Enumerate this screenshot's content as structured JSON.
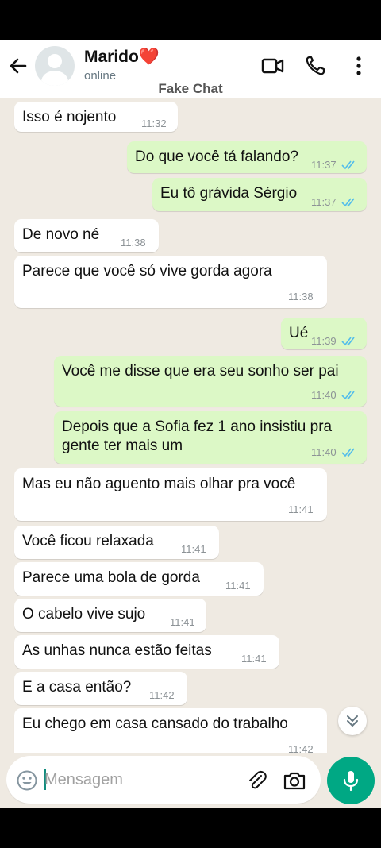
{
  "header": {
    "contact_name": "Marido❤️",
    "status": "online",
    "overlay_label": "Fake Chat"
  },
  "messages": [
    {
      "direction": "in",
      "text": "Isso é nojento",
      "time": "11:32"
    },
    {
      "direction": "out",
      "text": "Do que você tá falando?",
      "time": "11:37",
      "read": true
    },
    {
      "direction": "out",
      "text": "Eu tô grávida Sérgio",
      "time": "11:37",
      "read": true
    },
    {
      "direction": "in",
      "text": "De novo né",
      "time": "11:38"
    },
    {
      "direction": "in",
      "text": "Parece que você só vive gorda agora",
      "time": "11:38"
    },
    {
      "direction": "out",
      "text": "Ué",
      "time": "11:39",
      "read": true
    },
    {
      "direction": "out",
      "text": "Você me disse que era seu sonho ser pai",
      "time": "11:40",
      "read": true
    },
    {
      "direction": "out",
      "text": "Depois que a Sofia fez 1 ano insistiu pra\ngente ter mais um",
      "time": "11:40",
      "read": true
    },
    {
      "direction": "in",
      "text": "Mas eu não aguento mais olhar pra você",
      "time": "11:41"
    },
    {
      "direction": "in",
      "text": "Você ficou relaxada",
      "time": "11:41"
    },
    {
      "direction": "in",
      "text": "Parece uma bola de gorda",
      "time": "11:41"
    },
    {
      "direction": "in",
      "text": "O cabelo vive sujo",
      "time": "11:41"
    },
    {
      "direction": "in",
      "text": "As unhas nunca estão feitas",
      "time": "11:41"
    },
    {
      "direction": "in",
      "text": "E a casa então?",
      "time": "11:42"
    },
    {
      "direction": "in",
      "text": "Eu chego em casa cansado do trabalho",
      "time": "11:42"
    }
  ],
  "composer": {
    "placeholder": "Mensagem"
  },
  "icons": {
    "back": "arrow-left-icon",
    "video": "video-camera-icon",
    "call": "phone-icon",
    "menu": "more-vertical-icon",
    "emoji": "emoji-icon",
    "attach": "paperclip-icon",
    "camera": "camera-icon",
    "mic": "microphone-icon",
    "scroll": "double-chevron-down-icon",
    "read_ticks": "double-check-icon"
  },
  "colors": {
    "header_bg": "#ffffff",
    "chat_bg": "#efeae2",
    "incoming_bubble": "#ffffff",
    "outgoing_bubble": "#dcf8c6",
    "read_tick": "#53bdeb",
    "mic_button": "#00a884"
  }
}
